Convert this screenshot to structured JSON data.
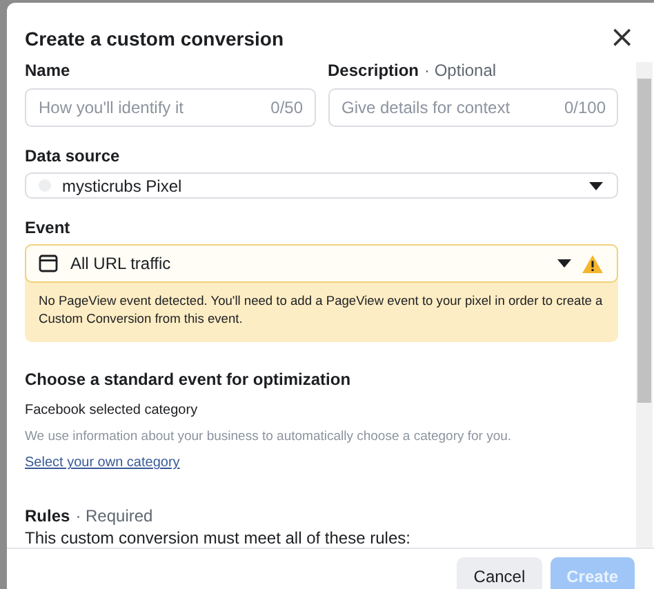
{
  "dialog": {
    "title": "Create a custom conversion",
    "close_icon": "×"
  },
  "name": {
    "label": "Name",
    "placeholder": "How you'll identify it",
    "count": "0/50"
  },
  "description": {
    "label": "Description",
    "optional": "· Optional",
    "placeholder": "Give details for context",
    "count": "0/100"
  },
  "data_source": {
    "label": "Data source",
    "value": "mysticrubs Pixel"
  },
  "event": {
    "label": "Event",
    "value": "All URL traffic",
    "warning": true,
    "warning_text": "No PageView event detected. You'll need to add a PageView event to your pixel in order to create a Custom Conversion from this event."
  },
  "optimization": {
    "heading": "Choose a standard event for optimization",
    "subheading": "Facebook selected category",
    "description": "We use information about your business to automatically choose a category for you.",
    "link": "Select your own category"
  },
  "rules": {
    "label": "Rules",
    "required": "· Required",
    "text": "This custom conversion must meet all of these rules:"
  },
  "buttons": [
    {
      "label": "Cancel",
      "kind": "secondary",
      "disabled": false
    },
    {
      "label": "Create",
      "kind": "primary",
      "disabled": true
    }
  ]
}
